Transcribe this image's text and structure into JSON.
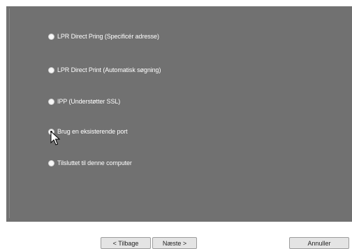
{
  "options": [
    {
      "label": "LPR Direct Pring (Specificér adresse)",
      "checked": false
    },
    {
      "label": "LPR Direct Print (Automatisk søgning)",
      "checked": false
    },
    {
      "label": "IPP (Understøtter SSL)",
      "checked": false
    },
    {
      "label": "Brug en eksisterende port",
      "checked": true
    },
    {
      "label": "Tilsluttet til denne computer",
      "checked": false
    }
  ],
  "buttons": {
    "back_label": "< Tilbage",
    "next_label": "Næste >",
    "cancel_label": "Annuller"
  }
}
